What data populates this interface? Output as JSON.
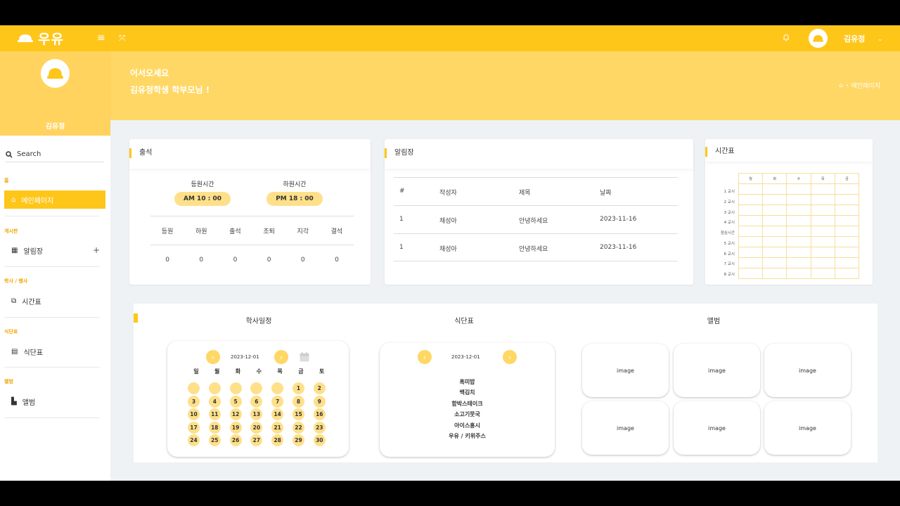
{
  "topbar": {
    "brand": "우유",
    "user_name": "김유정"
  },
  "sidebar": {
    "profile_name": "김유정",
    "search_placeholder": "Search",
    "sections": [
      {
        "label": "홈",
        "items": [
          {
            "label": "메인페이지",
            "active": true
          }
        ]
      },
      {
        "label": "게시판",
        "items": [
          {
            "label": "알림장",
            "expandable": true
          }
        ]
      },
      {
        "label": "학사 / 행사",
        "items": [
          {
            "label": "시간표"
          }
        ]
      },
      {
        "label": "식단표",
        "items": [
          {
            "label": "식단표"
          }
        ]
      },
      {
        "label": "앨범",
        "items": [
          {
            "label": "앨범"
          }
        ]
      }
    ]
  },
  "banner": {
    "line1": "어서오세요",
    "line2": "김유정학생 학부모님 !",
    "breadcrumb": "메인페이지"
  },
  "attendance": {
    "title": "출석",
    "arrive_label": "등원시간",
    "arrive_time": "AM 10 : 00",
    "leave_label": "하원시간",
    "leave_time": "PM 18 : 00",
    "headers": [
      "등원",
      "하원",
      "출석",
      "조퇴",
      "지각",
      "결석"
    ],
    "values": [
      "0",
      "0",
      "0",
      "0",
      "0",
      "0"
    ]
  },
  "notice": {
    "title": "알림장",
    "headers": [
      "#",
      "작성자",
      "제목",
      "날짜"
    ],
    "rows": [
      [
        "1",
        "채성아",
        "안녕하세요",
        "2023-11-16"
      ],
      [
        "1",
        "채성아",
        "안녕하세요",
        "2023-11-16"
      ]
    ]
  },
  "timetable": {
    "title": "시간표",
    "days": [
      "월",
      "화",
      "수",
      "목",
      "금"
    ],
    "periods": [
      "1 교시",
      "2 교시",
      "3 교시",
      "4 교시",
      "점심시간",
      "5 교시",
      "6 교시",
      "7 교시",
      "8 교시"
    ]
  },
  "bottom": {
    "calendar_title": "학사일정",
    "meal_title": "식단표",
    "album_title": "앨범",
    "calendar_date": "2023-12-01",
    "weekdays": [
      "일",
      "월",
      "화",
      "수",
      "목",
      "금",
      "토"
    ],
    "blank_leading": 5,
    "days_in_month": 30,
    "meal_date": "2023-12-01",
    "meal_items": [
      "흑미밥",
      "백김치",
      "함박스테이크",
      "소고기뭇국",
      "아이스홍시",
      "우유 / 키위주스"
    ],
    "album_items": [
      "image",
      "image",
      "image",
      "image",
      "image",
      "image"
    ]
  },
  "colors": {
    "accent": "#ffc61a",
    "accent_light": "#ffd764",
    "pill": "#ffe08a"
  }
}
